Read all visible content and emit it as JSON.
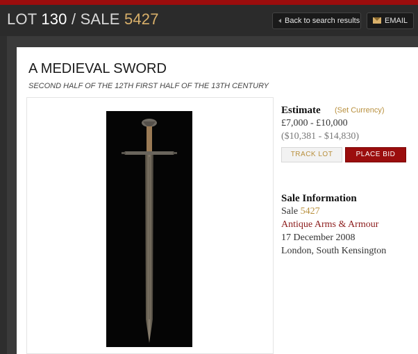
{
  "header": {
    "lot_label": "LOT",
    "lot_number": "130",
    "separator": "/",
    "sale_label": "SALE",
    "sale_number": "5427",
    "back_button": "Back to search results",
    "email_button": "EMAIL"
  },
  "lot": {
    "title": "A MEDIEVAL SWORD",
    "subtitle": "SECOND HALF OF THE 12TH FIRST HALF OF THE 13TH CENTURY"
  },
  "estimate": {
    "heading": "Estimate",
    "set_currency": "(Set Currency)",
    "gbp": "£7,000 - £10,000",
    "usd": "($10,381 - $14,830)"
  },
  "actions": {
    "track_lot": "TRACK LOT",
    "place_bid": "PLACE BID"
  },
  "sale_info": {
    "heading": "Sale Information",
    "sale_label": "Sale",
    "sale_number": "5427",
    "sale_name": "Antique Arms & Armour",
    "date": "17 December 2008",
    "location": "London, South Kensington"
  },
  "colors": {
    "accent_red": "#9b0d0d",
    "gold": "#b88f3c",
    "header_bg": "#2b2b2b"
  },
  "icons": {
    "email": "envelope-icon",
    "back": "back-arrow-icon"
  }
}
